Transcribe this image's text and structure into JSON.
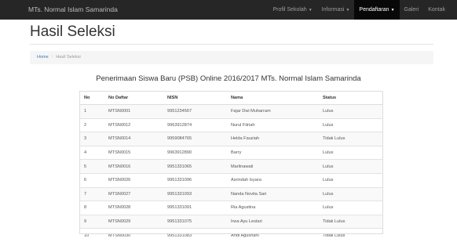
{
  "navbar": {
    "brand": "MTs. Normal Islam Samarinda",
    "items": [
      {
        "label": "Profil Sekolah",
        "dropdown": true,
        "active": false
      },
      {
        "label": "Informasi",
        "dropdown": true,
        "active": false
      },
      {
        "label": "Pendaftaran",
        "dropdown": true,
        "active": true
      },
      {
        "label": "Galeri",
        "dropdown": false,
        "active": false
      },
      {
        "label": "Kontak",
        "dropdown": false,
        "active": false
      }
    ]
  },
  "page": {
    "title": "Hasil Seleksi"
  },
  "breadcrumb": {
    "home": "Home",
    "separator": "/",
    "current": "Hasil Seleksi"
  },
  "content": {
    "heading": "Penerimaan Siswa Baru (PSB) Online 2016/2017 MTs. Normal Islam Samarinda"
  },
  "table": {
    "headers": [
      "No",
      "No Daftar",
      "NISN",
      "Nama",
      "Status"
    ],
    "rows": [
      [
        "1",
        "MTSN0001",
        "9951234567",
        "Fajar Dwi Muharram",
        "Lulus"
      ],
      [
        "2",
        "MTSN0012",
        "9963912874",
        "Nurul Fitriah",
        "Lulus"
      ],
      [
        "3",
        "MTSN0014",
        "9959084765",
        "Helda Fauziah",
        "Tidak Lulus"
      ],
      [
        "4",
        "MTSN0015",
        "9963912890",
        "Barry",
        "Lulus"
      ],
      [
        "5",
        "MTSN0016",
        "9951331065",
        "Marlinawati",
        "Lulus"
      ],
      [
        "6",
        "MTSN0026",
        "9951331096",
        "Asrindah Isyara",
        "Lulus"
      ],
      [
        "7",
        "MTSN0027",
        "9951331093",
        "Nanda Novita Sari",
        "Lulus"
      ],
      [
        "8",
        "MTSN0028",
        "9951331091",
        "Ria Agustina",
        "Lulus"
      ],
      [
        "9",
        "MTSN0029",
        "9951331075",
        "Irwa Ayu Lestari",
        "Tidak Lulus"
      ],
      [
        "10",
        "MTSN0030",
        "9951331083",
        "Andi Agusriani",
        "Tidak Lulus"
      ]
    ]
  },
  "colors": {
    "navbar_bg": "#262626",
    "navbar_active_bg": "#080808",
    "link": "#337ab7",
    "breadcrumb_bg": "#f5f5f5"
  }
}
